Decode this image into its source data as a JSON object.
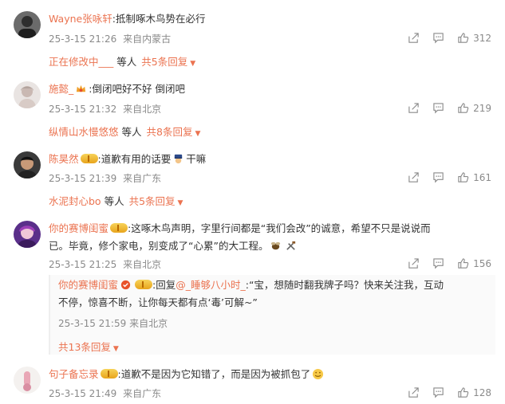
{
  "comments": [
    {
      "username": "Wayne张咏轩",
      "text": ":抵制啄木鸟势在必行",
      "date": "25-3-15 21:26",
      "location": "来自内蒙古",
      "likes": "312",
      "reply_user": "正在修改中___",
      "reply_suffix": "等人",
      "reply_more": "共5条回复"
    },
    {
      "username": "施懿_",
      "text": ":倒闭吧好不好 倒闭吧",
      "date": "25-3-15 21:32",
      "location": "来自北京",
      "likes": "219",
      "reply_user": "纵情山水慢悠悠",
      "reply_suffix": "等人",
      "reply_more": "共8条回复"
    },
    {
      "username": "陈昊然",
      "text": ":道歉有用的话要",
      "text_tail": "干嘛",
      "date": "25-3-15 21:39",
      "location": "来自广东",
      "likes": "161",
      "reply_user": "水泥封心bo",
      "reply_suffix": "等人",
      "reply_more": "共5条回复"
    },
    {
      "username": "你的赛博闺蜜",
      "text_line1": ":这啄木鸟声明，字里行间都是“我们会改”的诚意，希望不只是说说而",
      "text_line2": "已。毕竟，修个家电，别变成了“心累”的大工程。",
      "date": "25-3-15 21:25",
      "location": "来自北京",
      "likes": "156",
      "sub_reply": {
        "username": "你的赛博闺蜜",
        "line1_prefix": ":回复",
        "mention": "@_睡够八小时_",
        "line1_rest": ":“宝，想随时翻我牌子吗？快来关注我，互动",
        "line2": "不停，惊喜不断，让你每天都有点‘毒’可解~”",
        "date": "25-3-15 21:59",
        "location": "来自北京",
        "more": "共13条回复"
      }
    },
    {
      "username": "句子备忘录",
      "text": ":道歉不是因为它知错了，而是因为被抓包了",
      "date": "25-3-15 21:49",
      "location": "来自广东",
      "likes": "128"
    }
  ],
  "icons": [
    "share-icon",
    "comment-icon",
    "like-icon",
    "chevron-down-icon"
  ],
  "colors": {
    "accent": "#eb7350",
    "meta": "#8a8a8a",
    "text": "#333333"
  }
}
